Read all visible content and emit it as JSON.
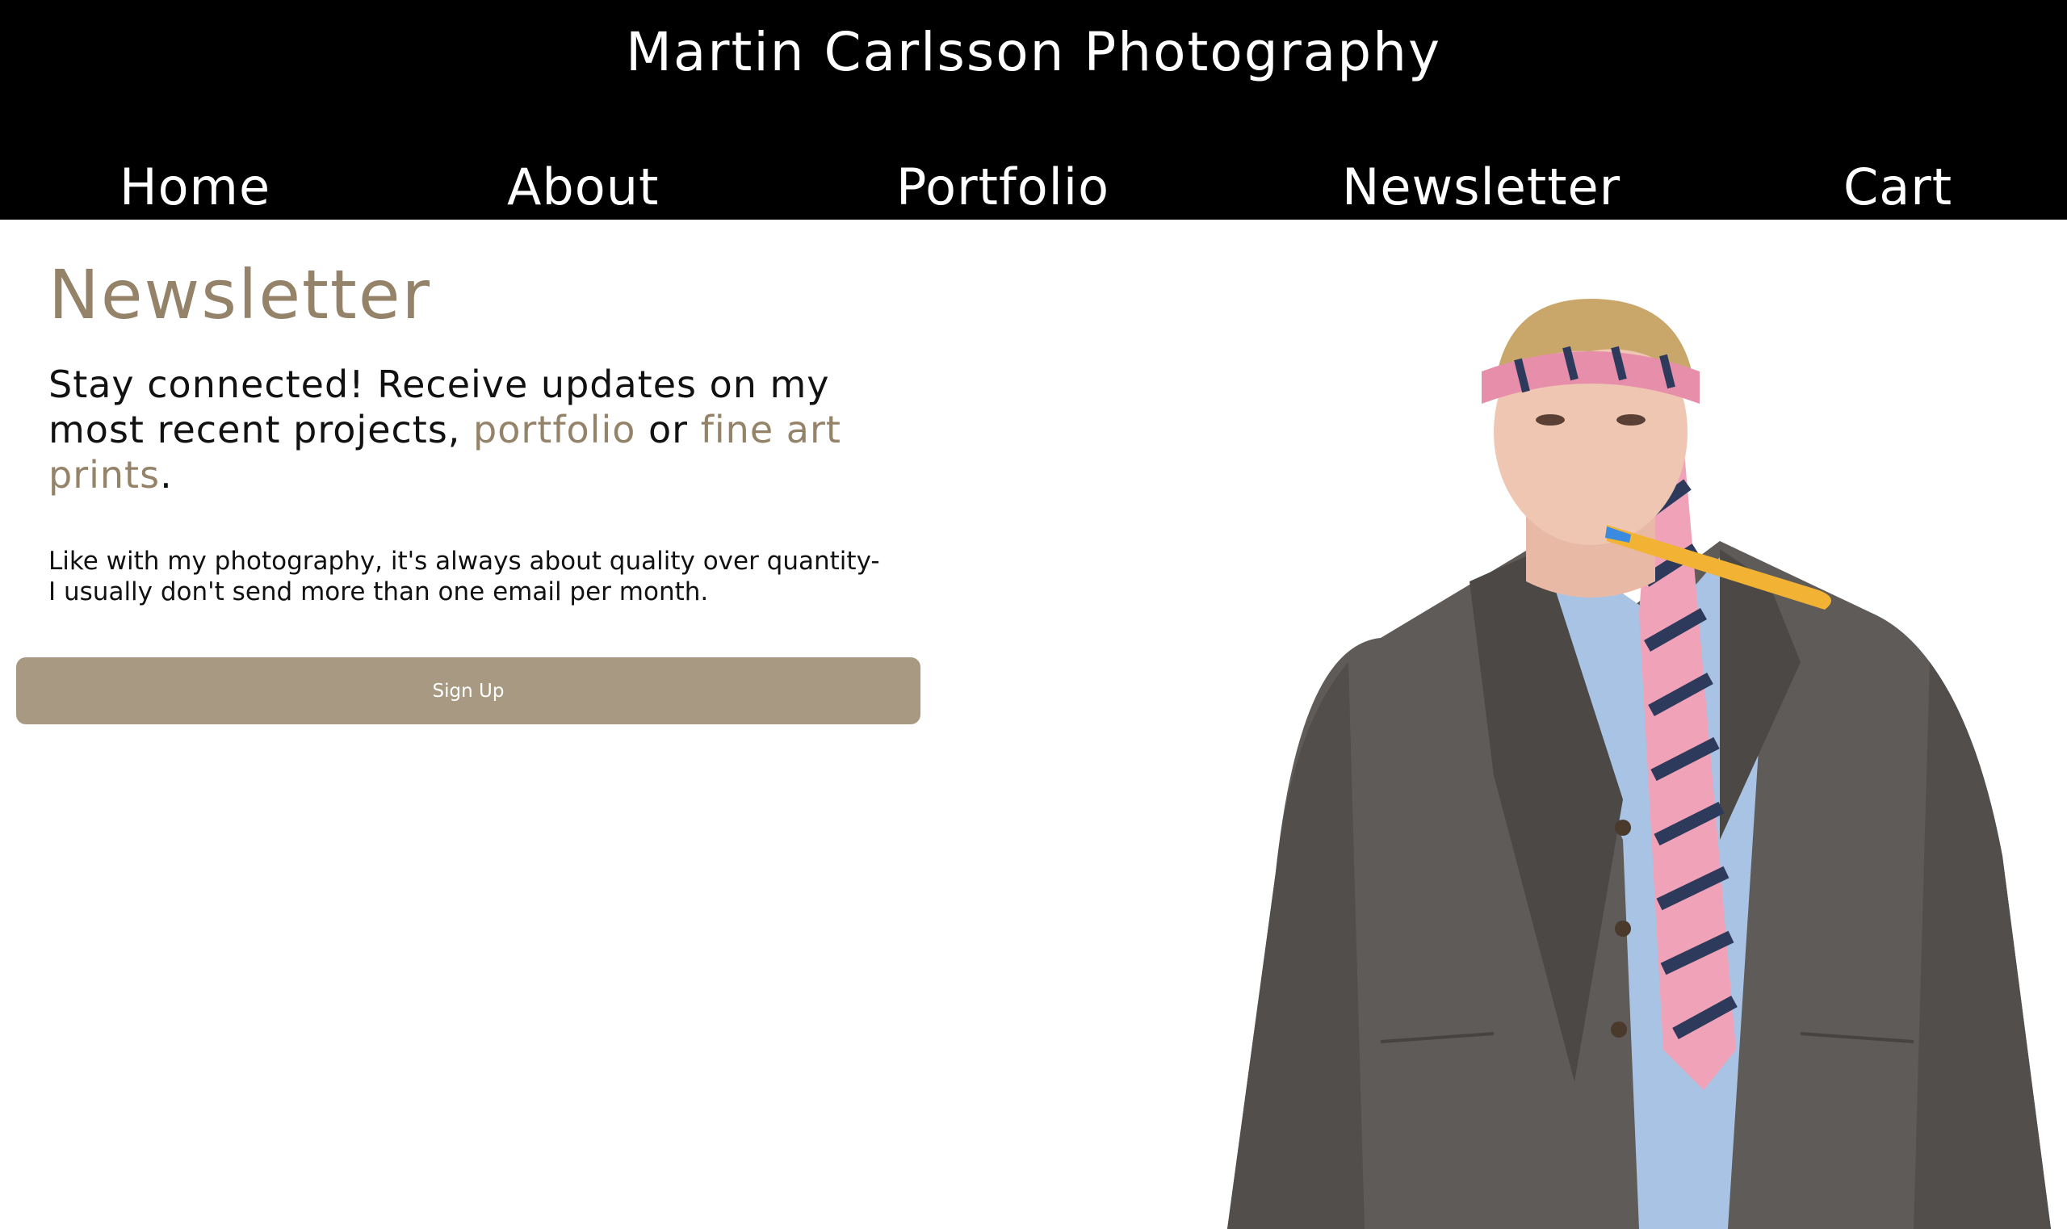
{
  "site": {
    "title": "Martin Carlsson Photography"
  },
  "nav": {
    "home": "Home",
    "about": "About",
    "portfolio": "Portfolio",
    "newsletter": "Newsletter",
    "cart": "Cart"
  },
  "main": {
    "heading": "Newsletter",
    "lead": {
      "part1": "Stay connected! Receive updates on my most recent projects, ",
      "link_portfolio": "portfolio",
      "part2": " or ",
      "link_prints": "fine art prints",
      "part3": "."
    },
    "body_line1": "Like with my photography, it's always about quality over quantity-",
    "body_line2": "I usually don't send more than one email per month.",
    "signup_label": "Sign Up"
  },
  "photo": {
    "subject": "man-in-suit-with-tie-on-head-and-party-horn"
  },
  "colors": {
    "header_bg": "#000000",
    "accent": "#948369",
    "button_bg": "#a89a82",
    "text": "#111111"
  }
}
